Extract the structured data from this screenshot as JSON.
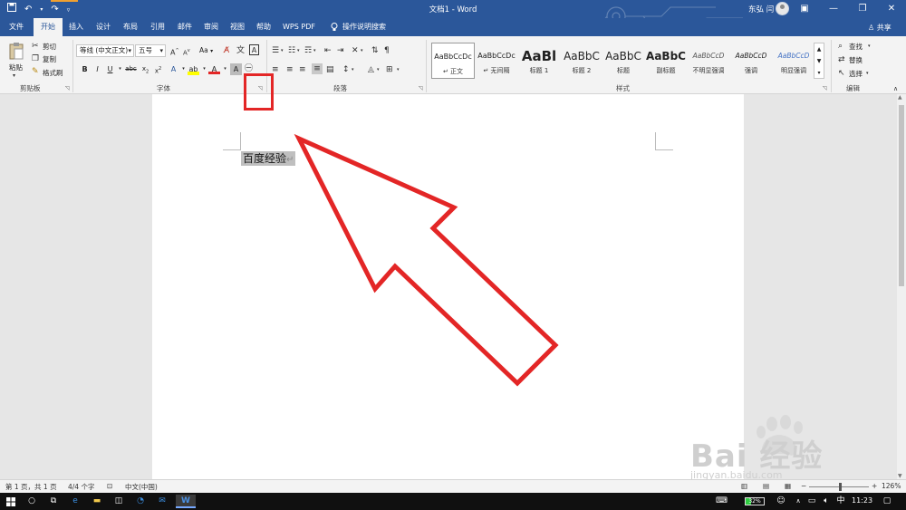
{
  "titlebar": {
    "title": "文档1  -  Word",
    "user": "东弘 闫",
    "qat": {
      "save_icon": "save-icon",
      "undo_icon": "undo-icon",
      "redo_icon": "redo-icon",
      "customize_icon": "customize-qat-icon"
    },
    "window_buttons": {
      "ribbon_options": "▣",
      "minimize": "—",
      "restore": "❐",
      "close": "✕"
    }
  },
  "tabs": {
    "items": [
      "文件",
      "开始",
      "插入",
      "设计",
      "布局",
      "引用",
      "邮件",
      "审阅",
      "视图",
      "帮助",
      "WPS PDF"
    ],
    "active": "开始",
    "tell_me": "操作说明搜索",
    "share": "共享"
  },
  "ribbon": {
    "clipboard": {
      "label": "剪贴板",
      "paste": "粘贴",
      "cut": "剪切",
      "copy": "复制",
      "format_painter": "格式刷"
    },
    "font": {
      "label": "字体",
      "font_name": "等线 (中文正文)",
      "font_size": "五号",
      "aa_label": "Aa"
    },
    "paragraph": {
      "label": "段落"
    },
    "styles": {
      "label": "样式",
      "items": [
        {
          "sample": "AaBbCcDc",
          "name": "↵ 正文"
        },
        {
          "sample": "AaBbCcDc",
          "name": "↵ 无间隔"
        },
        {
          "sample": "AaBl",
          "name": "标题 1"
        },
        {
          "sample": "AaBbC",
          "name": "标题 2"
        },
        {
          "sample": "AaBbC",
          "name": "标题"
        },
        {
          "sample": "AaBbC",
          "name": "副标题"
        },
        {
          "sample": "AaBbCcD",
          "name": "不明显强调"
        },
        {
          "sample": "AaBbCcD",
          "name": "强调"
        },
        {
          "sample": "AaBbCcD",
          "name": "明显强调"
        }
      ]
    },
    "editing": {
      "label": "编辑",
      "find": "查找",
      "replace": "替换",
      "select": "选择"
    }
  },
  "document": {
    "text": "百度经验",
    "paragraph_mark": "↵"
  },
  "statusbar": {
    "page": "第 1 页，共 1 页",
    "words": "4/4 个字",
    "language": "中文(中国)",
    "zoom": "126%"
  },
  "taskbar": {
    "time": "11:23",
    "battery": "32%"
  },
  "watermark": {
    "brand": "Bai 经验",
    "url": "jingyan.baidu.com"
  },
  "colors": {
    "word_blue": "#2b579a",
    "annotation_red": "#e32626",
    "ribbon_bg": "#f3f3f3",
    "canvas_bg": "#e6e6e6"
  }
}
